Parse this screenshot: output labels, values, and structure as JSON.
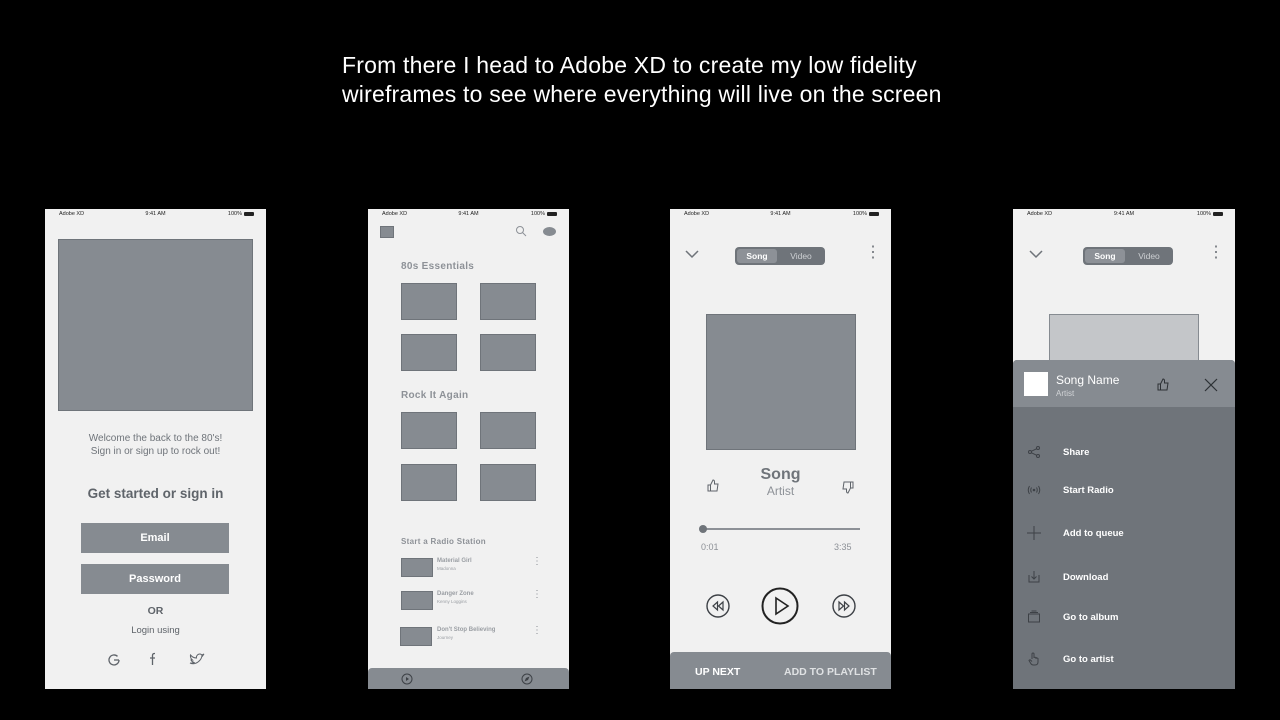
{
  "slide": {
    "title_line1": "From there I head to Adobe XD to create my low fidelity",
    "title_line2": "wireframes to see where everything will live on the screen"
  },
  "status_bar": {
    "carrier": "Adobe XD",
    "time": "9:41 AM",
    "battery": "100%"
  },
  "login": {
    "welcome_line1": "Welcome the back to the 80's!",
    "welcome_line2": "Sign in or sign up to rock out!",
    "heading": "Get started or sign in",
    "email_button": "Email",
    "password_button": "Password",
    "or_text": "OR",
    "login_using": "Login using",
    "social_icons": [
      "google-icon",
      "facebook-icon",
      "twitter-icon"
    ]
  },
  "browse": {
    "section1": "80s Essentials",
    "section2": "Rock It Again",
    "section3": "Start a Radio Station",
    "stations": [
      {
        "title": "Material Girl",
        "artist": "Madonna"
      },
      {
        "title": "Danger Zone",
        "artist": "Kenny Loggins"
      },
      {
        "title": "Don't Stop Believing",
        "artist": "Journey"
      }
    ]
  },
  "player": {
    "toggle_song": "Song",
    "toggle_video": "Video",
    "song": "Song",
    "artist": "Artist",
    "elapsed": "0:01",
    "duration": "3:35",
    "progress": 0.0,
    "up_next": "UP NEXT",
    "add_to_playlist": "ADD TO PLAYLIST"
  },
  "options": {
    "toggle_song": "Song",
    "toggle_video": "Video",
    "song_name": "Song Name",
    "artist": "Artist",
    "menu": [
      "Share",
      "Start Radio",
      "Add to queue",
      "Download",
      "Go to album",
      "Go to artist"
    ]
  },
  "colors": {
    "background": "#000000",
    "screen": "#f1f1f1",
    "placeholder": "#868b91",
    "sheet": "#6f747a"
  }
}
